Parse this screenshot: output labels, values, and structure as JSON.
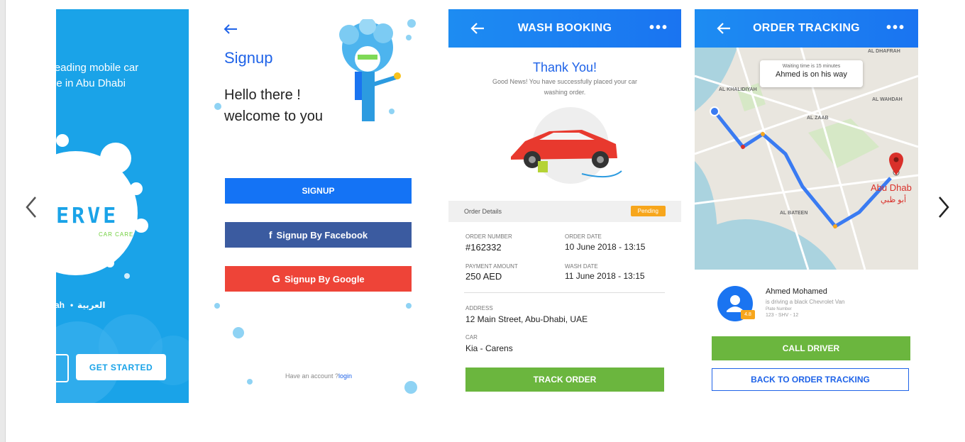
{
  "carousel": {
    "prev_icon": "chevron-left-icon",
    "next_icon": "chevron-right-icon"
  },
  "splash": {
    "tagline_line1": "e leading mobile car",
    "tagline_line2": "vice in Abu Dhabi",
    "brand": "ERVE",
    "brand_sub": "CAR CARE",
    "lang_en": "ah",
    "lang_separator": "•",
    "lang_ar": "العربية",
    "get_started": "GET STARTED",
    "colors": {
      "background": "#1aa3e8",
      "accent": "#6fcf3c"
    }
  },
  "signup": {
    "back_icon": "arrow-left-icon",
    "title": "Signup",
    "greeting_line1": "Hello there !",
    "greeting_line2": "welcome to you",
    "signup_button": "SIGNUP",
    "facebook_button": "Signup By Facebook",
    "google_button": "Signup By Google",
    "have_account": "Have an account ?",
    "login_link": "login",
    "colors": {
      "primary": "#1473f5",
      "facebook": "#3b5ba0",
      "google": "#ee4438"
    }
  },
  "wash_booking": {
    "header_title": "WASH BOOKING",
    "more_icon": "more-dots-icon",
    "thank_you": "Thank You!",
    "message": "Good News! You have successfully placed your car washing order.",
    "order_details_label": "Order Details",
    "status": "Pending",
    "order_number_label": "ORDER NUMBER",
    "order_number": "#162332",
    "order_date_label": "ORDER DATE",
    "order_date": "10 June 2018 - 13:15",
    "payment_amount_label": "PAYMENT AMOUNT",
    "payment_amount": "250 AED",
    "wash_date_label": "WASH DATE",
    "wash_date": "11 June 2018 - 13:15",
    "address_label": "ADDRESS",
    "address": "12 Main Street, Abu-Dhabi, UAE",
    "car_label": "CAR",
    "car": "Kia - Carens",
    "track_button": "TRACK ORDER",
    "colors": {
      "header": "#1a74f1",
      "pending": "#f7a61c",
      "action": "#6bb63e"
    }
  },
  "order_tracking": {
    "header_title": "ORDER TRACKING",
    "waiting_time": "Waiting time is 15 minutes",
    "on_the_way": "Ahmed is on his way",
    "map_labels": [
      "AL DHAFRAH",
      "AL KHALIDIYAH",
      "AL WAHDAH",
      "AL ZAAB",
      "AL BATEEN"
    ],
    "city": "Abu Dhab",
    "city_ar": "أبو ظبي",
    "driver_name": "Ahmed Mohamed",
    "driver_sub": "is driving a black Chevrolet Van",
    "plate_label": "Plate Number",
    "plate": "123 - SHV - 12",
    "driver_rating": "4.8",
    "call_button": "CALL DRIVER",
    "back_button": "BACK TO ORDER TRACKING"
  }
}
